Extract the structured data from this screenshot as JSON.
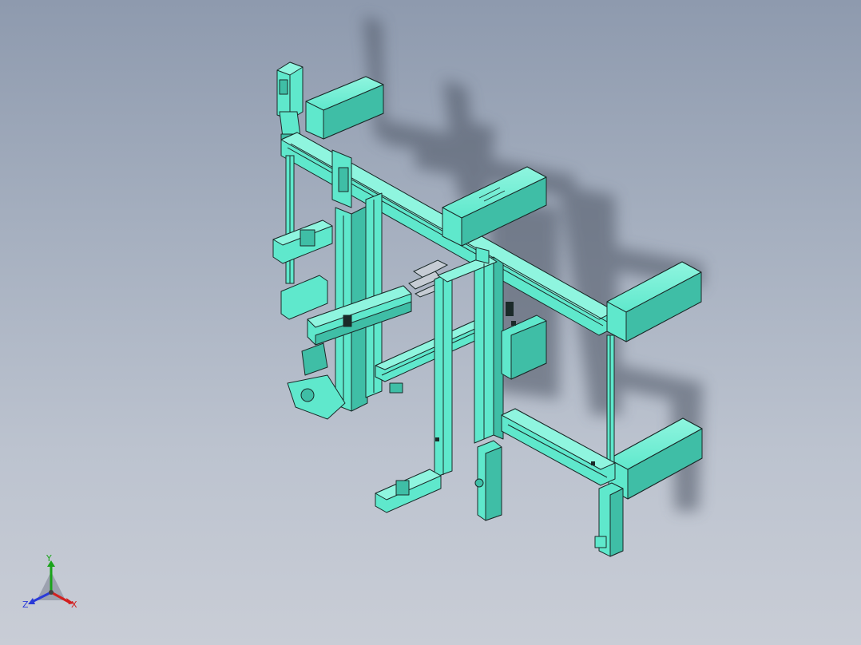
{
  "viewport": {
    "background_top": "#8e9aae",
    "background_bottom": "#c9cdd6",
    "model": {
      "part_color": "#5fe8cc",
      "part_shade": "#3fbea6",
      "edge_color": "#1b2a29",
      "shadow_color": "#4a5160"
    }
  },
  "triad": {
    "y_label": "Y",
    "z_label": "Z",
    "x_label": "X",
    "y_color": "#1aa31a",
    "z_color": "#2a3ad8",
    "x_color": "#d21f1f"
  }
}
